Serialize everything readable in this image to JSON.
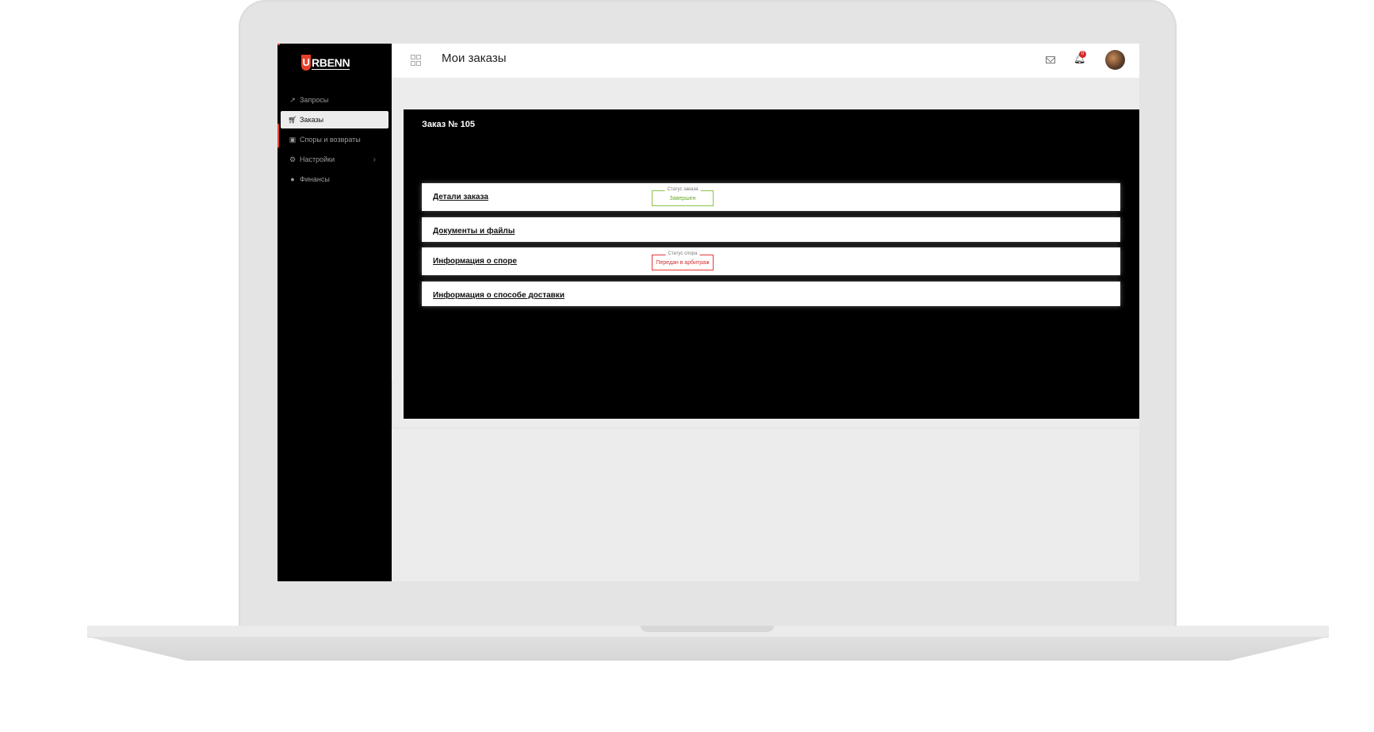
{
  "app": {
    "logo_text": "RBENN",
    "logo_letter": "U"
  },
  "header": {
    "title": "Мои заказы",
    "notification_count": "0"
  },
  "sidebar": {
    "items": [
      {
        "label": "Запросы",
        "icon": "share-icon"
      },
      {
        "label": "Заказы",
        "icon": "cart-icon"
      },
      {
        "label": "Споры и возвраты",
        "icon": "returns-icon"
      },
      {
        "label": "Настройки",
        "icon": "gear-icon"
      },
      {
        "label": "Финансы",
        "icon": "finance-icon"
      }
    ]
  },
  "order": {
    "title": "Заказ № 105",
    "sections": {
      "details": {
        "label": "Детали заказа",
        "status_caption": "Статус заказа",
        "status_value": "Завершен"
      },
      "documents": {
        "label": "Документы и файлы"
      },
      "dispute": {
        "label": "Информация о споре",
        "status_caption": "Статус спора",
        "status_value": "Передан в арбитраж"
      },
      "delivery": {
        "label": "Информация о способе доставки"
      }
    }
  },
  "colors": {
    "accent": "#e8402a",
    "status_success": "#8bc34a",
    "status_danger": "#e53935"
  }
}
